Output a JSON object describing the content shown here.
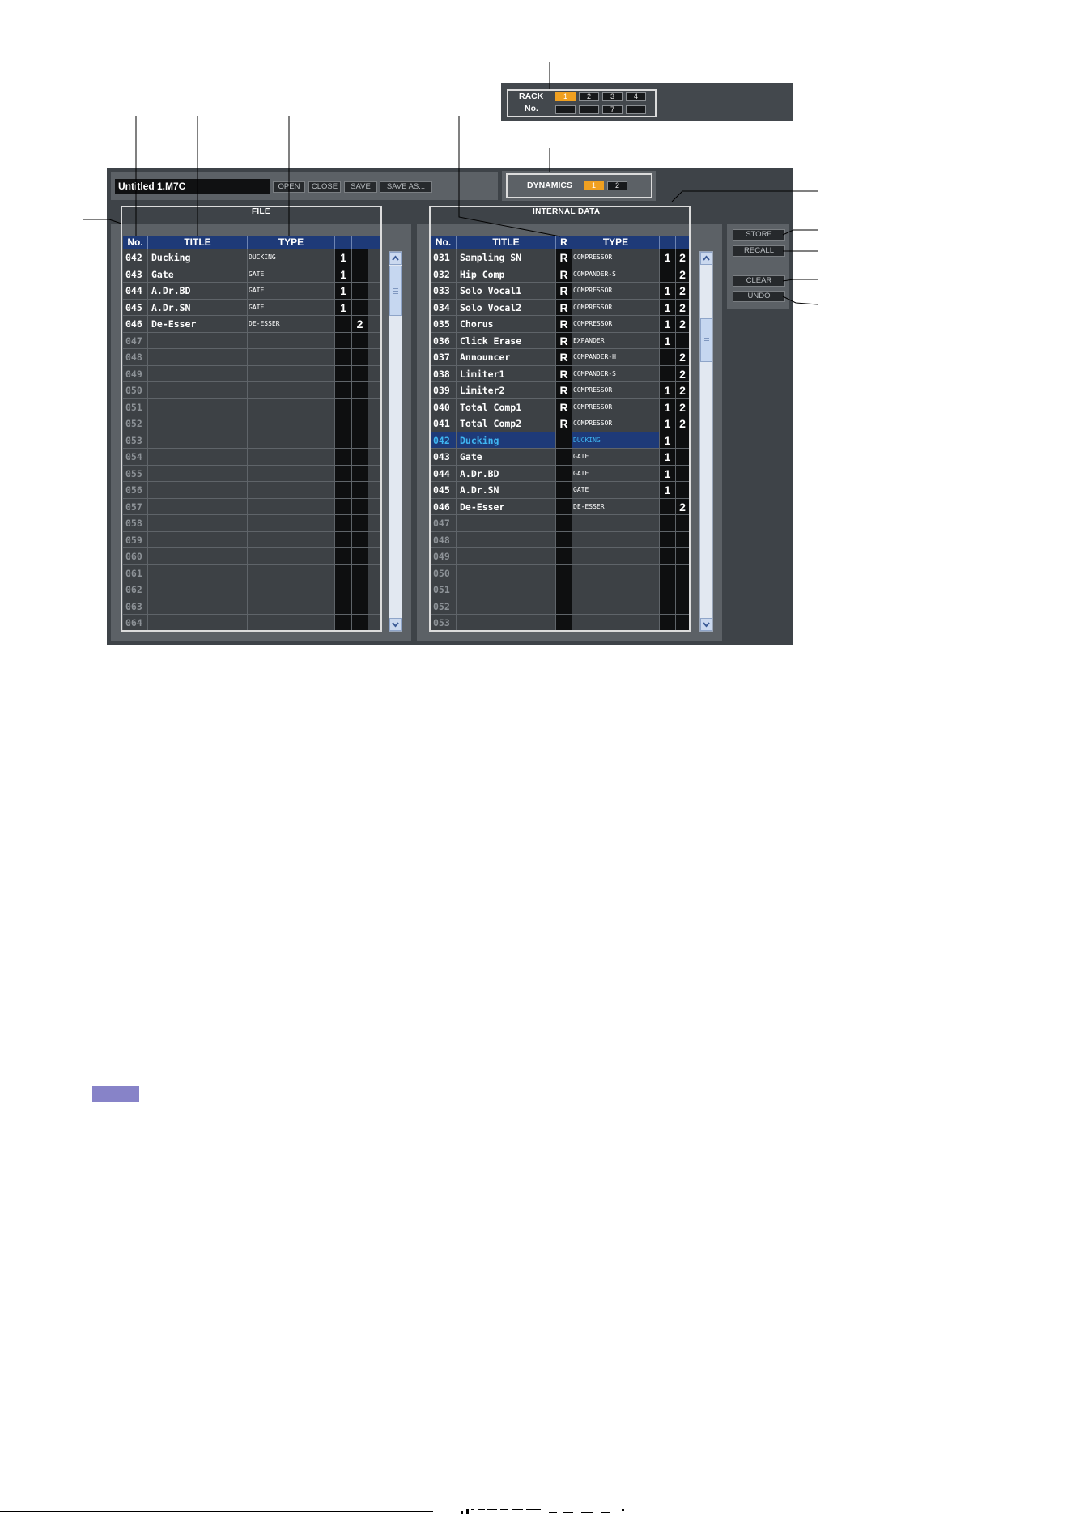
{
  "colors": {
    "accent": "#f0a020",
    "header": "#1e3a78",
    "selected_text": "#3fb6f2",
    "note": "#8783c8"
  },
  "rack_selector": {
    "label_line1": "RACK",
    "label_line2": "No.",
    "buttons": [
      {
        "label": "1",
        "active": true
      },
      {
        "label": "2",
        "active": false
      },
      {
        "label": "3",
        "active": false
      },
      {
        "label": "4",
        "active": false
      },
      {
        "label": "",
        "active": false
      },
      {
        "label": "",
        "active": false
      },
      {
        "label": "7",
        "active": false
      },
      {
        "label": "",
        "active": false
      }
    ]
  },
  "file_bar": {
    "filename": "Untitled 1.M7C",
    "open": "OPEN",
    "close": "CLOSE",
    "save": "SAVE",
    "save_as": "SAVE AS..."
  },
  "dynamics_selector": {
    "label": "DYNAMICS",
    "buttons": [
      {
        "label": "1",
        "active": true
      },
      {
        "label": "2",
        "active": false
      }
    ]
  },
  "file_panel": {
    "title": "FILE",
    "columns": {
      "no": "No.",
      "title": "TITLE",
      "type": "TYPE"
    },
    "rows": [
      {
        "no": "042",
        "title": "Ducking",
        "type": "DUCKING",
        "slot1": "1"
      },
      {
        "no": "043",
        "title": "Gate",
        "type": "GATE",
        "slot1": "1"
      },
      {
        "no": "044",
        "title": "A.Dr.BD",
        "type": "GATE",
        "slot1": "1"
      },
      {
        "no": "045",
        "title": "A.Dr.SN",
        "type": "GATE",
        "slot1": "1"
      },
      {
        "no": "046",
        "title": "De-Esser",
        "type": "DE-ESSER",
        "slot2": "2"
      },
      {
        "no": "047"
      },
      {
        "no": "048"
      },
      {
        "no": "049"
      },
      {
        "no": "050"
      },
      {
        "no": "051"
      },
      {
        "no": "052"
      },
      {
        "no": "053"
      },
      {
        "no": "054"
      },
      {
        "no": "055"
      },
      {
        "no": "056"
      },
      {
        "no": "057"
      },
      {
        "no": "058"
      },
      {
        "no": "059"
      },
      {
        "no": "060"
      },
      {
        "no": "061"
      },
      {
        "no": "062"
      },
      {
        "no": "063"
      },
      {
        "no": "064"
      }
    ]
  },
  "internal_panel": {
    "title": "INTERNAL DATA",
    "columns": {
      "no": "No.",
      "title": "TITLE",
      "r": "R",
      "type": "TYPE"
    },
    "rows": [
      {
        "no": "031",
        "title": "Sampling SN",
        "r": "R",
        "type": "COMPRESSOR",
        "slot1": "1",
        "slot2": "2"
      },
      {
        "no": "032",
        "title": "Hip Comp",
        "r": "R",
        "type": "COMPANDER-S",
        "slot2": "2"
      },
      {
        "no": "033",
        "title": "Solo Vocal1",
        "r": "R",
        "type": "COMPRESSOR",
        "slot1": "1",
        "slot2": "2"
      },
      {
        "no": "034",
        "title": "Solo Vocal2",
        "r": "R",
        "type": "COMPRESSOR",
        "slot1": "1",
        "slot2": "2"
      },
      {
        "no": "035",
        "title": "Chorus",
        "r": "R",
        "type": "COMPRESSOR",
        "slot1": "1",
        "slot2": "2"
      },
      {
        "no": "036",
        "title": "Click Erase",
        "r": "R",
        "type": "EXPANDER",
        "slot1": "1"
      },
      {
        "no": "037",
        "title": "Announcer",
        "r": "R",
        "type": "COMPANDER-H",
        "slot2": "2"
      },
      {
        "no": "038",
        "title": "Limiter1",
        "r": "R",
        "type": "COMPANDER-S",
        "slot2": "2"
      },
      {
        "no": "039",
        "title": "Limiter2",
        "r": "R",
        "type": "COMPRESSOR",
        "slot1": "1",
        "slot2": "2"
      },
      {
        "no": "040",
        "title": "Total Comp1",
        "r": "R",
        "type": "COMPRESSOR",
        "slot1": "1",
        "slot2": "2"
      },
      {
        "no": "041",
        "title": "Total Comp2",
        "r": "R",
        "type": "COMPRESSOR",
        "slot1": "1",
        "slot2": "2"
      },
      {
        "no": "042",
        "title": "Ducking",
        "type": "DUCKING",
        "slot1": "1",
        "selected": true
      },
      {
        "no": "043",
        "title": "Gate",
        "type": "GATE",
        "slot1": "1"
      },
      {
        "no": "044",
        "title": "A.Dr.BD",
        "type": "GATE",
        "slot1": "1"
      },
      {
        "no": "045",
        "title": "A.Dr.SN",
        "type": "GATE",
        "slot1": "1"
      },
      {
        "no": "046",
        "title": "De-Esser",
        "type": "DE-ESSER",
        "slot2": "2"
      },
      {
        "no": "047"
      },
      {
        "no": "048"
      },
      {
        "no": "049"
      },
      {
        "no": "050"
      },
      {
        "no": "051"
      },
      {
        "no": "052"
      },
      {
        "no": "053"
      }
    ]
  },
  "actions": {
    "store": "STORE",
    "recall": "RECALL",
    "clear": "CLEAR",
    "undo": "UNDO"
  }
}
